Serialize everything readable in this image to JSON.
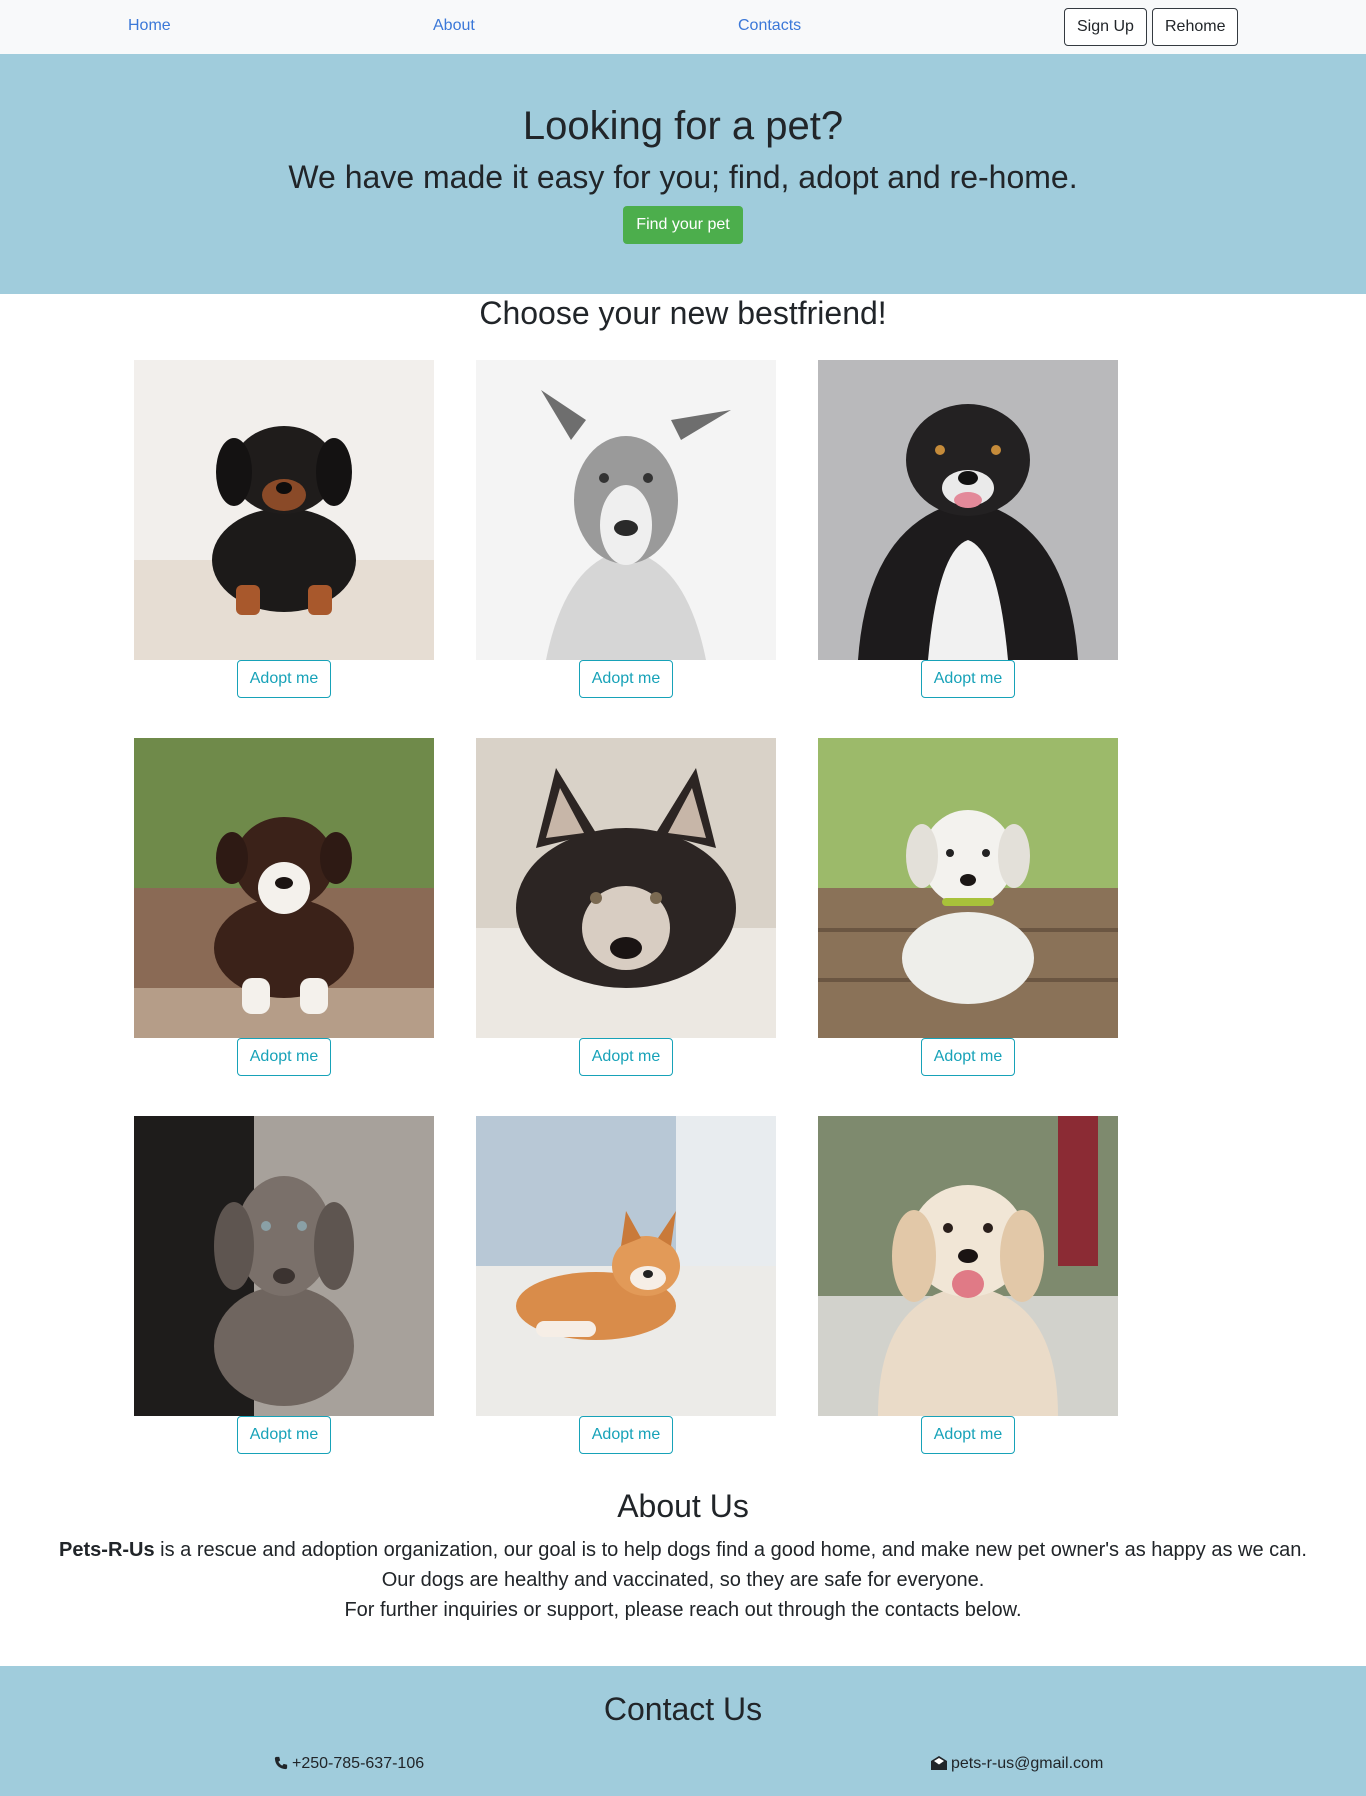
{
  "nav": {
    "links": [
      "Home",
      "About",
      "Contacts"
    ],
    "signup_label": "Sign Up",
    "rehome_label": "Rehome"
  },
  "hero": {
    "title": "Looking for a pet?",
    "subtitle": "We have made it easy for you; find, adopt and re-home.",
    "button_label": "Find your pet"
  },
  "pets": {
    "title": "Choose your new bestfriend!",
    "adopt_label": "Adopt me",
    "cards": [
      {
        "photo": "black-tan-puppy-photo"
      },
      {
        "photo": "grey-white-dog-photo"
      },
      {
        "photo": "black-white-longhair-dog-photo"
      },
      {
        "photo": "brown-white-puppy-photo"
      },
      {
        "photo": "husky-puppy-photo"
      },
      {
        "photo": "white-puppy-photo"
      },
      {
        "photo": "weimaraner-puppy-photo"
      },
      {
        "photo": "shiba-inu-photo"
      },
      {
        "photo": "golden-retriever-photo"
      }
    ]
  },
  "about": {
    "title": "About Us",
    "brand": "Pets-R-Us",
    "line1_rest": " is a rescue and adoption organization, our goal is to help dogs find a good home, and make new pet owner's as happy as we can.",
    "line2": "Our dogs are healthy and vaccinated, so they are safe for everyone.",
    "line3": "For further inquiries or support, please reach out through the contacts below."
  },
  "contact": {
    "title": "Contact Us",
    "phone": "+250-785-637-106",
    "email": "pets-r-us@gmail.com"
  },
  "colors": {
    "hero_bg": "#a0ccdc",
    "nav_bg": "#f8f9fa",
    "link": "#3b78d8",
    "find_button": "#4cae4c",
    "adopt_button": "#17a2b8"
  }
}
